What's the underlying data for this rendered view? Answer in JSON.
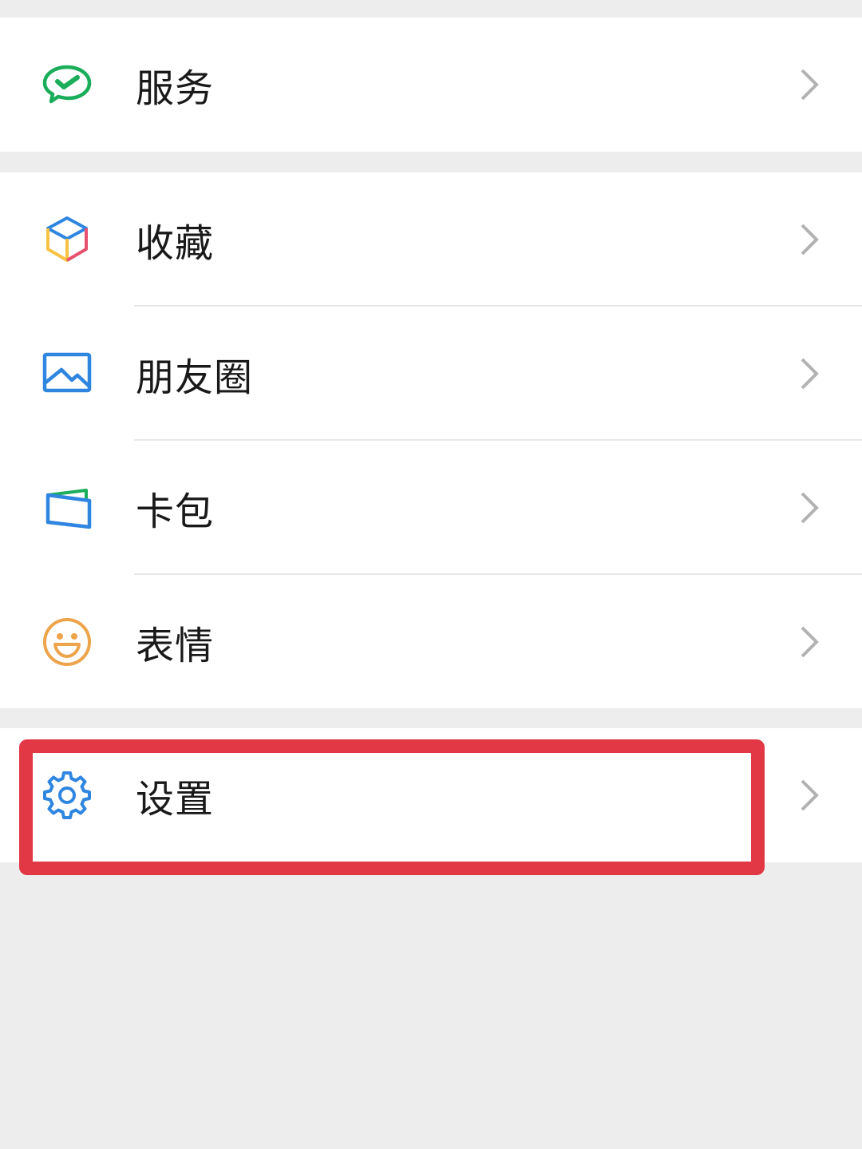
{
  "menu": {
    "groups": [
      {
        "items": [
          {
            "label": "服务",
            "icon": "wechat-pay-check-icon"
          }
        ]
      },
      {
        "items": [
          {
            "label": "收藏",
            "icon": "favorites-cube-icon"
          },
          {
            "label": "朋友圈",
            "icon": "moments-image-icon"
          },
          {
            "label": "卡包",
            "icon": "card-wallet-icon"
          },
          {
            "label": "表情",
            "icon": "sticker-smiley-icon"
          }
        ]
      },
      {
        "items": [
          {
            "label": "设置",
            "icon": "settings-gear-icon"
          }
        ]
      }
    ],
    "chevron_icon": "chevron-right-icon"
  },
  "annotation": {
    "highlighted_item": "设置",
    "color": "#e23744"
  },
  "colors": {
    "background": "#ededed",
    "row_background": "#ffffff",
    "text": "#191919",
    "chevron": "#b2b2b2",
    "service_green": "#1aad5a",
    "icon_blue": "#2f86e0",
    "emoji_orange": "#eda44a"
  }
}
